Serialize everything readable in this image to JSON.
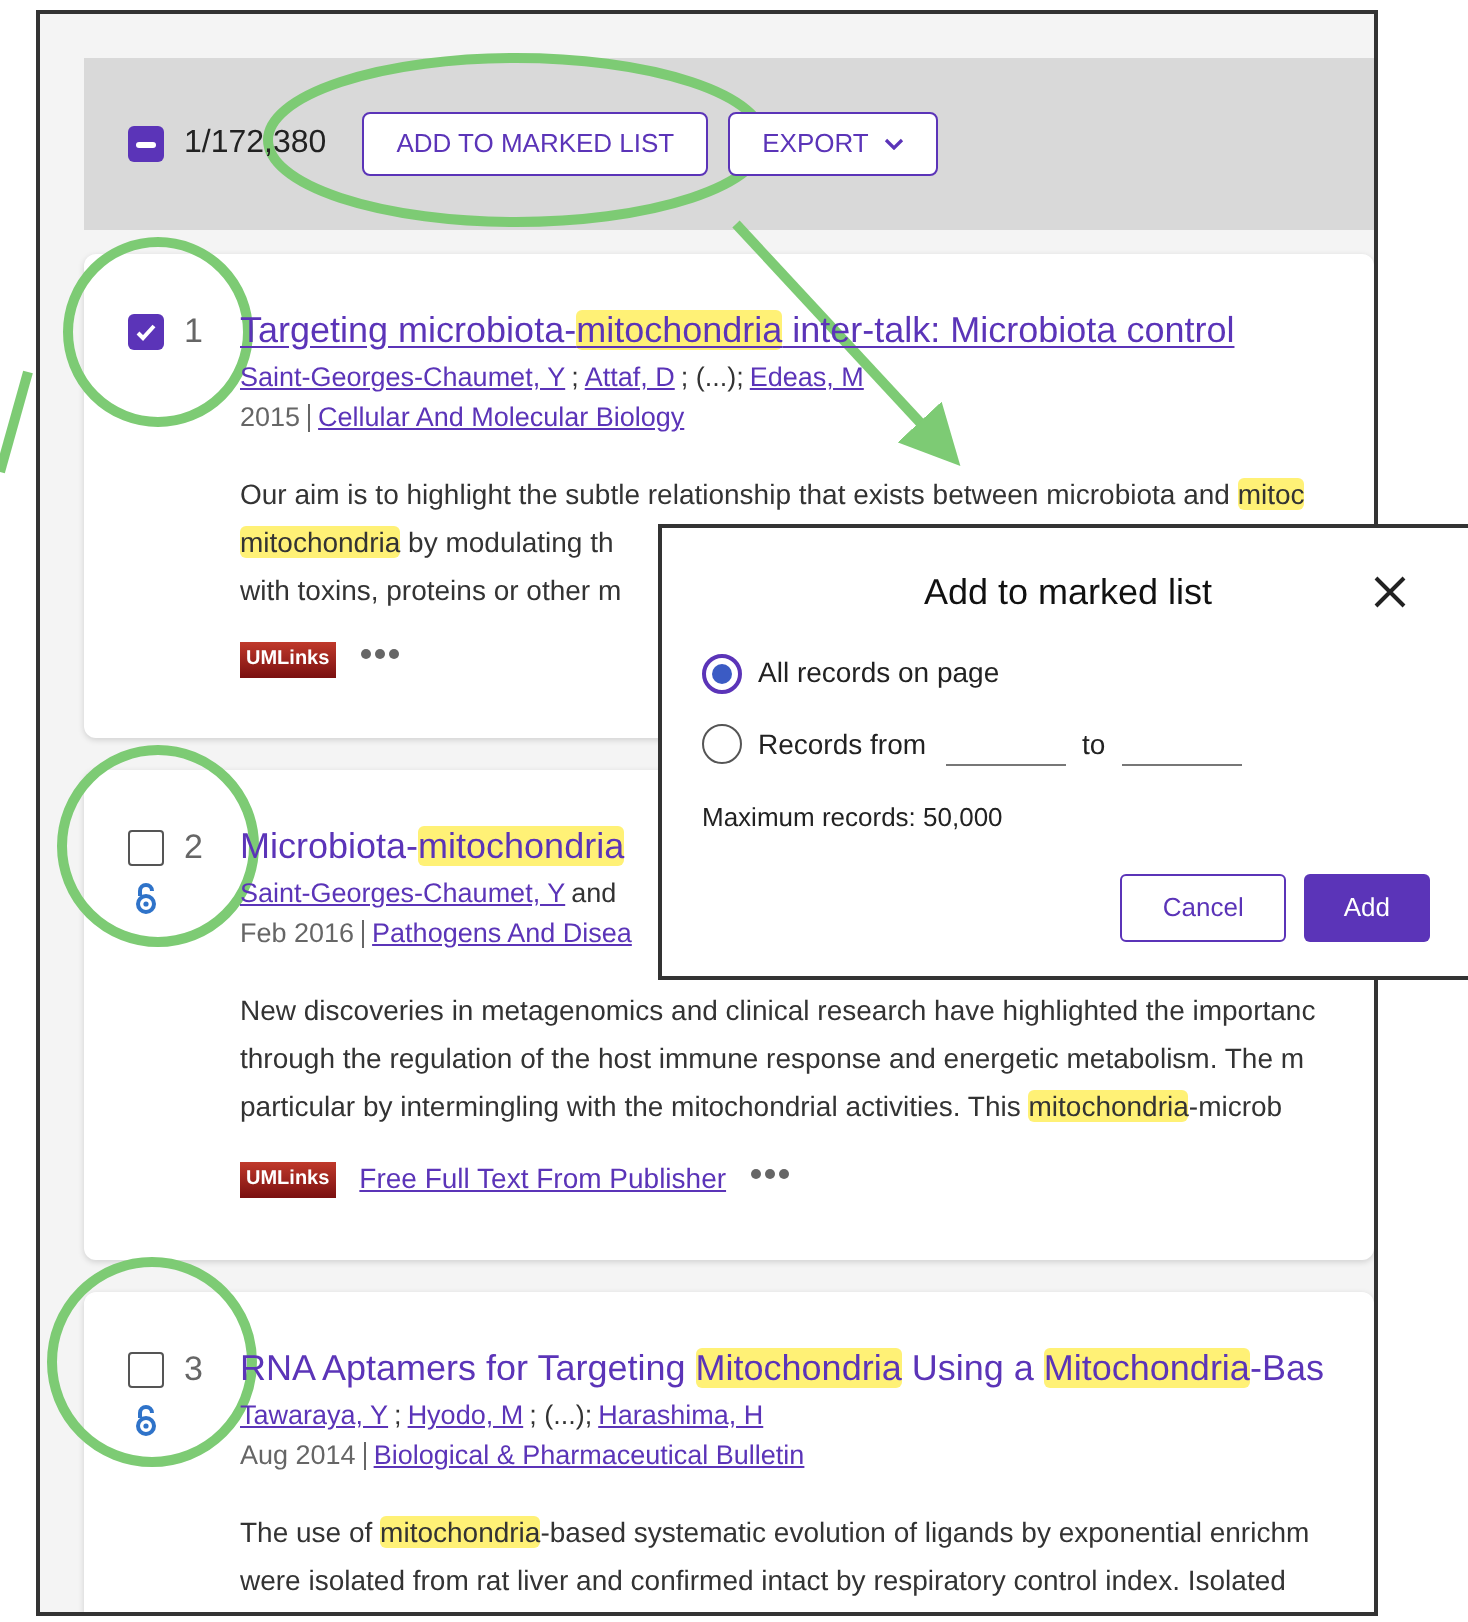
{
  "toolbar": {
    "select_all": {
      "indeterminate": true
    },
    "count": "1/172,380",
    "buttons": [
      {
        "label": "ADD TO MARKED LIST",
        "kind": "plain"
      },
      {
        "label": "EXPORT",
        "kind": "dropdown"
      }
    ]
  },
  "records": [
    {
      "number": "1",
      "selected": true,
      "open_access": false,
      "title": [
        {
          "text": "Targeting microbiota-",
          "highlight": false
        },
        {
          "text": "mitochondria",
          "highlight": true
        },
        {
          "text": " inter-talk: Microbiota control",
          "highlight": false
        }
      ],
      "authors": [
        {
          "text": "Saint-Georges-Chaumet, Y",
          "kind": "link"
        },
        {
          "text": ";",
          "kind": "text"
        },
        {
          "text": "Attaf, D",
          "kind": "link"
        },
        {
          "text": "; (...);",
          "kind": "text"
        },
        {
          "text": "Edeas, M",
          "kind": "link"
        }
      ],
      "date": "2015",
      "source": "Cellular And Molecular Biology",
      "abstract": [
        [
          {
            "text": "Our aim is to highlight the subtle relationship that exists between microbiota and ",
            "highlight": false
          },
          {
            "text": "mitoc",
            "highlight": true
          }
        ],
        [
          {
            "text": "mitochondria",
            "highlight": true
          },
          {
            "text": " by modulating th",
            "highlight": false
          }
        ],
        [
          {
            "text": "with toxins, proteins or other m",
            "highlight": false
          }
        ]
      ],
      "links": [
        {
          "kind": "logo",
          "text": "UMLinks"
        },
        {
          "kind": "more"
        }
      ]
    },
    {
      "number": "2",
      "selected": false,
      "open_access": true,
      "title": [
        {
          "text": "Microbiota-",
          "highlight": false
        },
        {
          "text": "mitochondria",
          "highlight": true
        }
      ],
      "authors": [
        {
          "text": "Saint-Georges-Chaumet, Y",
          "kind": "link"
        },
        {
          "text": "and",
          "kind": "text"
        }
      ],
      "date": "Feb 2016",
      "source": "Pathogens And Disea",
      "abstract": [
        [
          {
            "text": "New discoveries in metagenomics and clinical research have highlighted the importanc",
            "highlight": false
          }
        ],
        [
          {
            "text": "through the regulation of the host immune response and energetic metabolism. The m",
            "highlight": false
          }
        ],
        [
          {
            "text": "particular by intermingling with the mitochondrial activities. This ",
            "highlight": false
          },
          {
            "text": "mitochondria",
            "highlight": true
          },
          {
            "text": "-microb",
            "highlight": false
          }
        ]
      ],
      "links": [
        {
          "kind": "logo",
          "text": "UMLinks"
        },
        {
          "kind": "link",
          "text": "Free Full Text From Publisher"
        },
        {
          "kind": "more"
        }
      ]
    },
    {
      "number": "3",
      "selected": false,
      "open_access": true,
      "title": [
        {
          "text": "RNA Aptamers for Targeting ",
          "highlight": false
        },
        {
          "text": "Mitochondria",
          "highlight": true
        },
        {
          "text": " Using a ",
          "highlight": false
        },
        {
          "text": "Mitochondria",
          "highlight": true
        },
        {
          "text": "-Bas",
          "highlight": false
        }
      ],
      "authors": [
        {
          "text": "Tawaraya, Y",
          "kind": "link"
        },
        {
          "text": ";",
          "kind": "text"
        },
        {
          "text": "Hyodo, M",
          "kind": "link"
        },
        {
          "text": "; (...);",
          "kind": "text"
        },
        {
          "text": "Harashima, H",
          "kind": "link"
        }
      ],
      "date": "Aug 2014",
      "source": "Biological & Pharmaceutical Bulletin",
      "abstract": [
        [
          {
            "text": "The use of ",
            "highlight": false
          },
          {
            "text": "mitochondria",
            "highlight": true
          },
          {
            "text": "-based systematic evolution of ligands by exponential enrichm",
            "highlight": false
          }
        ],
        [
          {
            "text": "were isolated from rat liver and confirmed intact by respiratory control index. Isolated",
            "highlight": false
          }
        ]
      ]
    }
  ],
  "dialog": {
    "title": "Add to marked list",
    "options": [
      {
        "kind": "all",
        "label": "All records on page",
        "selected": true
      },
      {
        "kind": "range",
        "label": "Records from",
        "to_label": "to",
        "selected": false
      }
    ],
    "note": "Maximum records: 50,000",
    "buttons": [
      {
        "label": "Cancel",
        "kind": "secondary"
      },
      {
        "label": "Add",
        "kind": "primary"
      }
    ]
  }
}
